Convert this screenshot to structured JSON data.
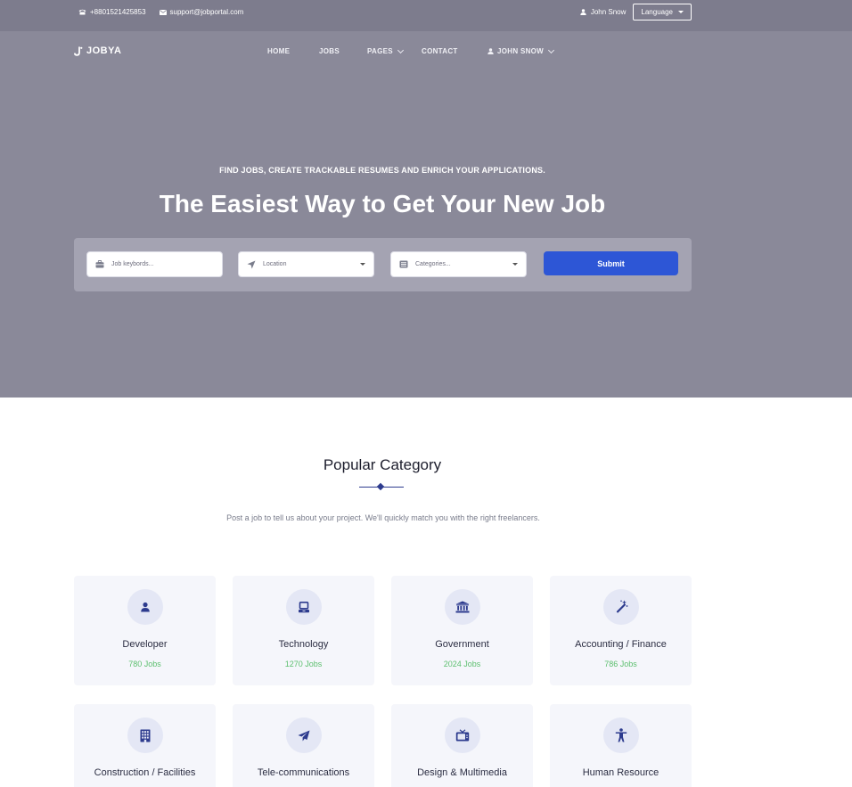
{
  "topbar": {
    "phone": "+8801521425853",
    "email": "support@jobportal.com",
    "user": "John Snow",
    "language_label": "Language"
  },
  "brand": {
    "logo_text": "JOBYA"
  },
  "nav": {
    "items": [
      {
        "label": "HOME"
      },
      {
        "label": "JOBS"
      },
      {
        "label": "PAGES"
      },
      {
        "label": "CONTACT"
      },
      {
        "label": "JOHN SNOW"
      }
    ]
  },
  "hero": {
    "subtitle": "FIND JOBS, CREATE TRACKABLE RESUMES AND ENRICH YOUR APPLICATIONS.",
    "headline": "The Easiest Way to Get Your New Job",
    "search": {
      "keywords_placeholder": "Job keybords...",
      "location_placeholder": "Location",
      "categories_placeholder": "Categories...",
      "submit_label": "Submit"
    }
  },
  "popular": {
    "title": "Popular Category",
    "description": "Post a job to tell us about your project. We'll quickly match you with the right freelancers.",
    "categories": [
      {
        "name": "Developer",
        "count": "780 Jobs",
        "icon": "user-icon"
      },
      {
        "name": "Technology",
        "count": "1270 Jobs",
        "icon": "laptop-icon"
      },
      {
        "name": "Government",
        "count": "2024 Jobs",
        "icon": "building-columns-icon"
      },
      {
        "name": "Accounting / Finance",
        "count": "786 Jobs",
        "icon": "magic-wand-icon"
      },
      {
        "name": "Construction / Facilities",
        "count": "",
        "icon": "building-icon"
      },
      {
        "name": "Tele-communications",
        "count": "",
        "icon": "paper-plane-icon"
      },
      {
        "name": "Design & Multimedia",
        "count": "",
        "icon": "tv-icon"
      },
      {
        "name": "Human Resource",
        "count": "",
        "icon": "person-icon"
      }
    ]
  },
  "colors": {
    "hero_bg": "#8a8999",
    "topbar_bg": "#7d7c8d",
    "accent_blue": "#2d56d6",
    "icon_blue": "#2d3b8e",
    "jobs_green": "#5cbf6e",
    "card_bg": "#f5f6fb"
  }
}
